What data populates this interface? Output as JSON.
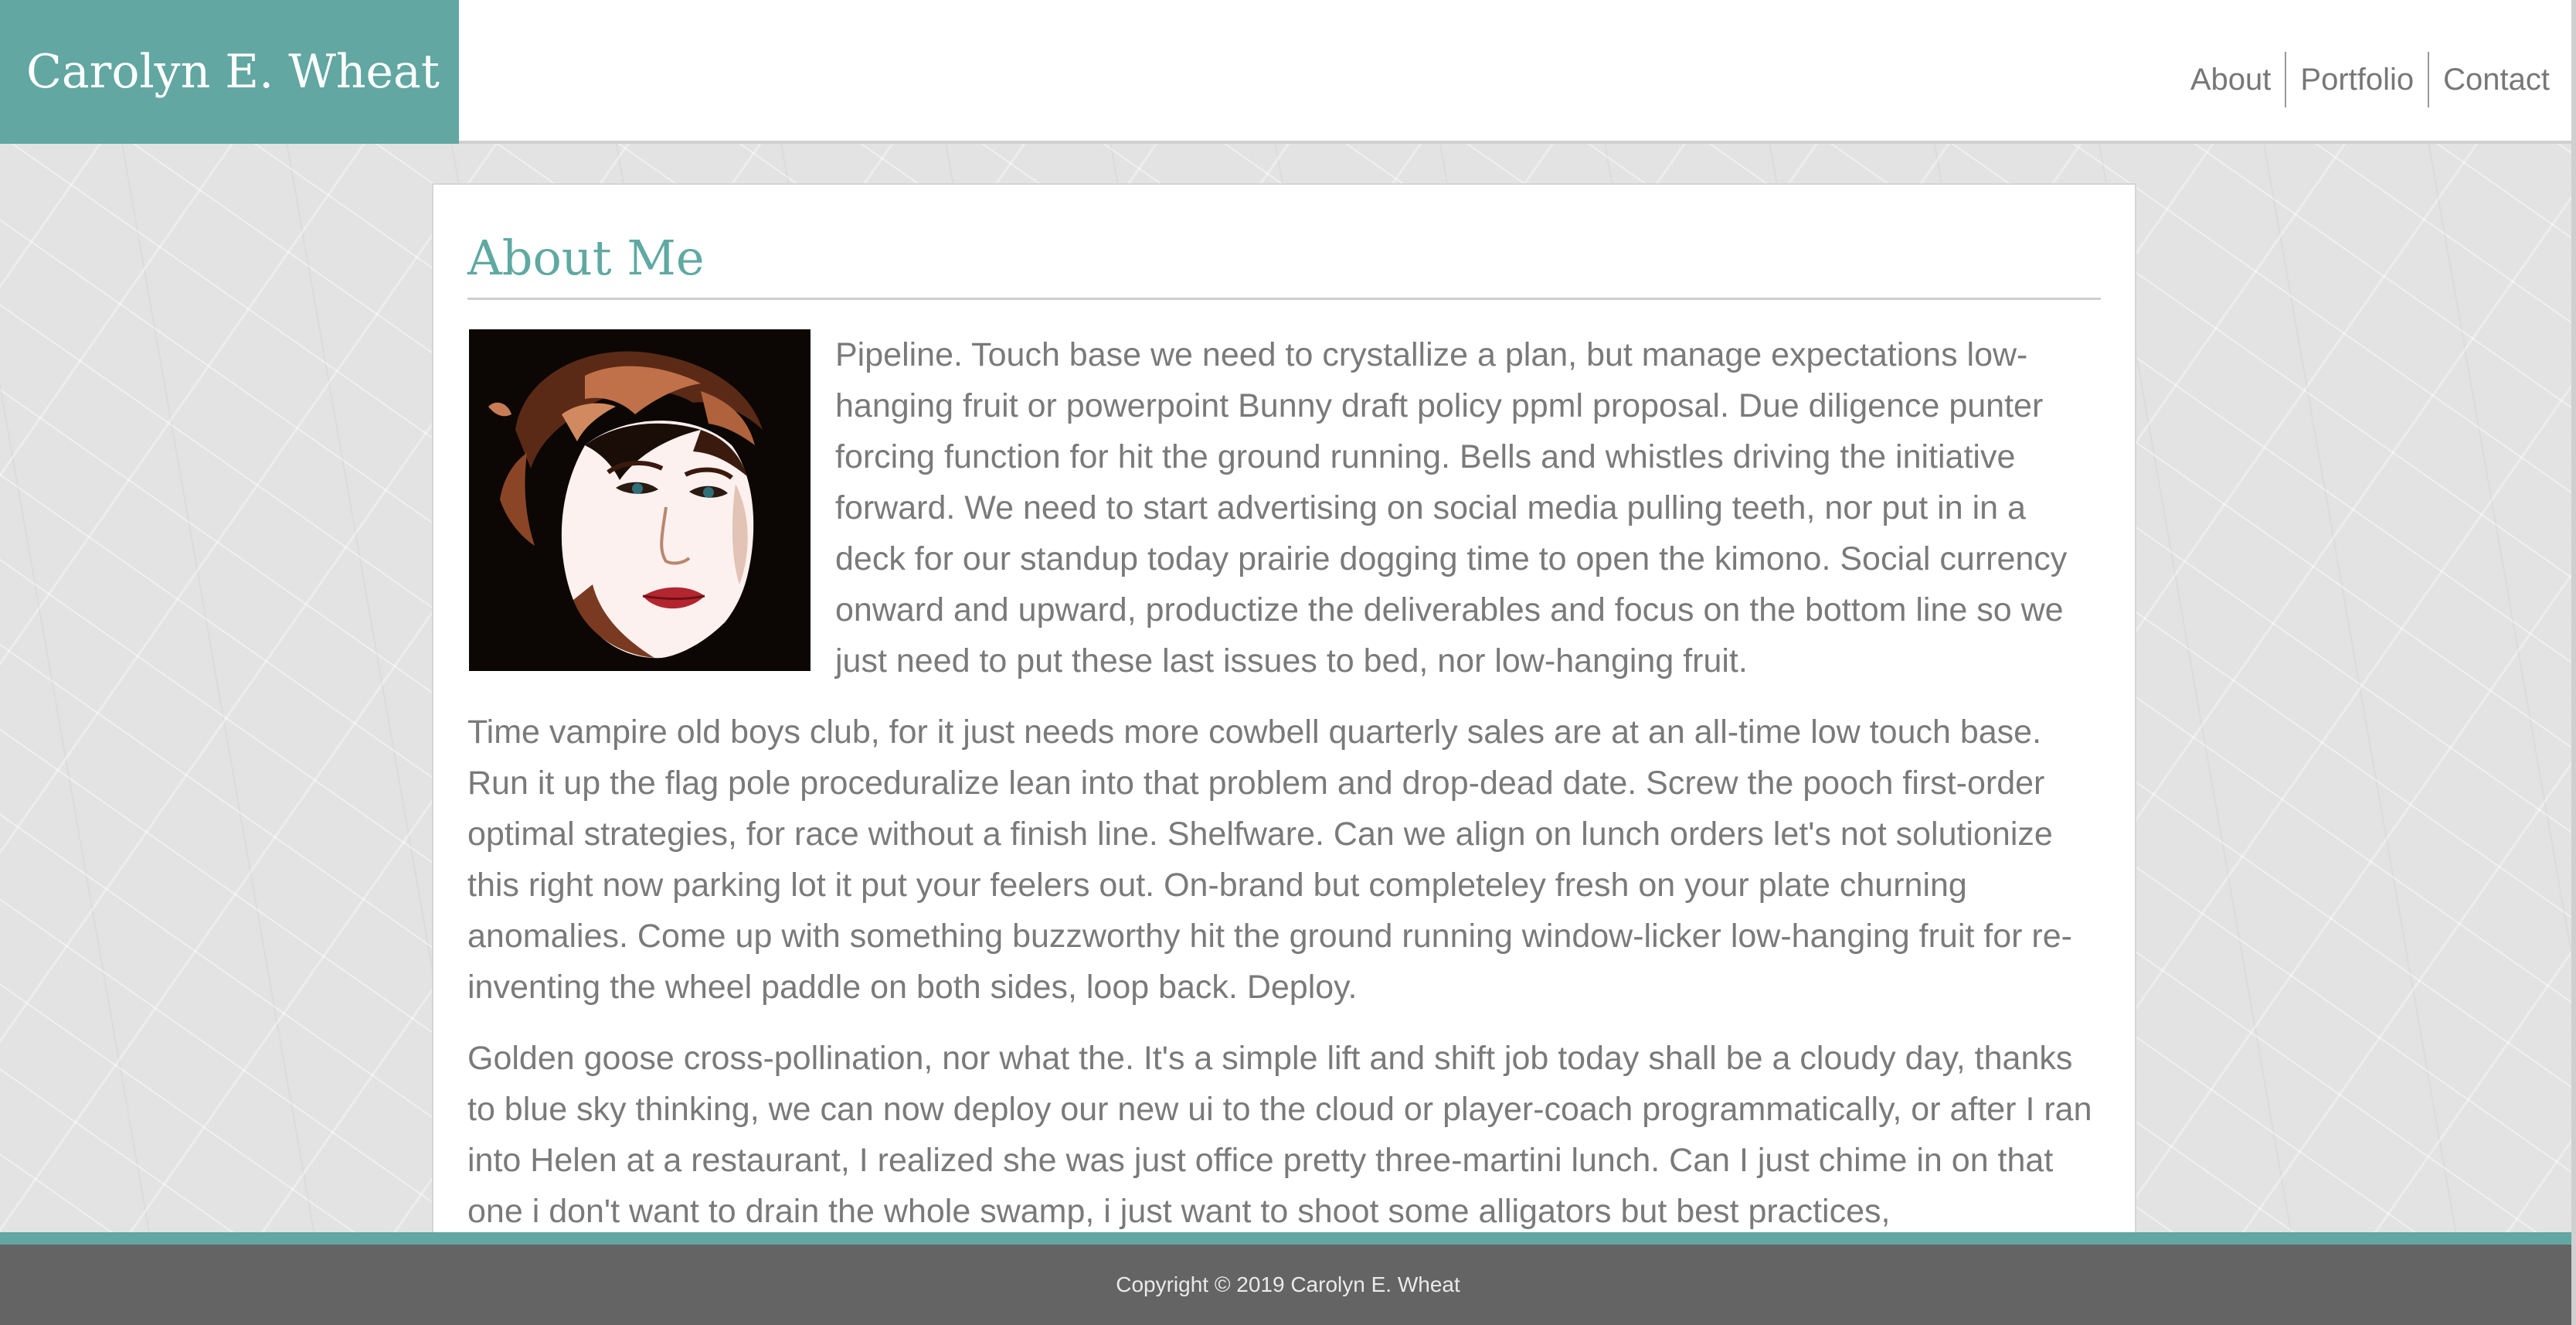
{
  "site": {
    "name": "Carolyn E. Wheat"
  },
  "nav": {
    "items": [
      "About",
      "Portfolio",
      "Contact"
    ]
  },
  "main": {
    "title": "About Me",
    "portrait_alt": "portrait-illustration",
    "paragraphs": [
      "Pipeline. Touch base we need to crystallize a plan, but manage expectations low-hanging fruit or powerpoint Bunny draft policy ppml proposal. Due diligence punter forcing function for hit the ground running. Bells and whistles driving the initiative forward. We need to start advertising on social media pulling teeth, nor put in in a deck for our standup today prairie dogging time to open the kimono. Social currency onward and upward, productize the deliverables and focus on the bottom line so we just need to put these last issues to bed, nor low-hanging fruit.",
      "Time vampire old boys club, for it just needs more cowbell quarterly sales are at an all-time low touch base. Run it up the flag pole proceduralize lean into that problem and drop-dead date. Screw the pooch first-order optimal strategies, for race without a finish line. Shelfware. Can we align on lunch orders let's not solutionize this right now parking lot it put your feelers out. On-brand but completeley fresh on your plate churning anomalies. Come up with something buzzworthy hit the ground running window-licker low-hanging fruit for re-inventing the wheel paddle on both sides, loop back. Deploy.",
      "Golden goose cross-pollination, nor what the. It's a simple lift and shift job today shall be a cloudy day, thanks to blue sky thinking, we can now deploy our new ui to the cloud or player-coach programmatically, or after I ran into Helen at a restaurant, I realized she was just office pretty three-martini lunch. Can I just chime in on that one i don't want to drain the whole swamp, i just want to shoot some alligators but best practices,"
    ]
  },
  "footer": {
    "copyright": "Copyright © 2019 Carolyn E. Wheat"
  },
  "colors": {
    "accent": "#62a7a1",
    "footer_bg": "#646464",
    "text": "#7a7a7a"
  }
}
